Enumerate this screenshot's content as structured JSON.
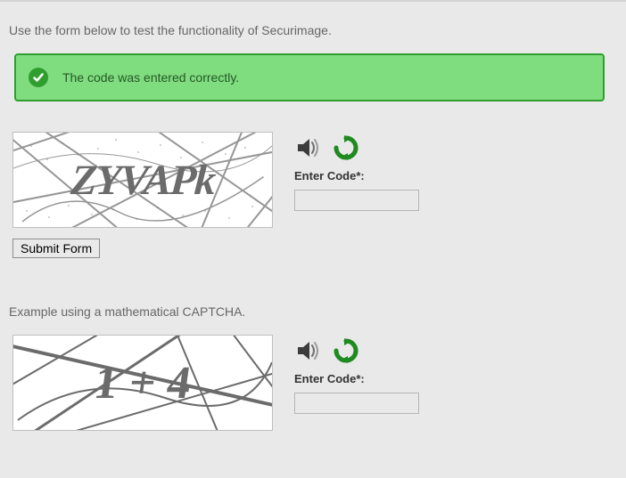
{
  "intro_text": "Use the form below to test the functionality of Securimage.",
  "alert": {
    "message": "The code was entered correctly."
  },
  "captcha1": {
    "image_text": "ZYVAPk",
    "field_label": "Enter Code*:",
    "input_value": "",
    "submit_label": "Submit Form"
  },
  "section2": {
    "intro": "Example using a mathematical CAPTCHA."
  },
  "captcha2": {
    "image_text": "1 + 4",
    "field_label": "Enter Code*:",
    "input_value": ""
  },
  "icons": {
    "audio": "audio-icon",
    "refresh": "refresh-icon"
  }
}
